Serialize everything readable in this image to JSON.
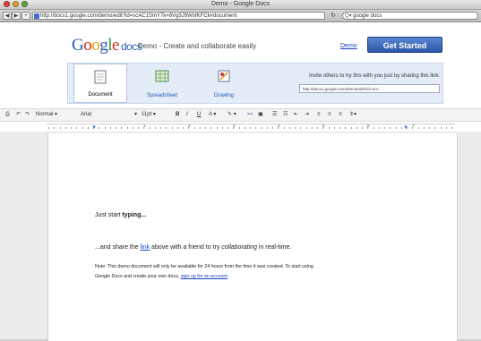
{
  "window": {
    "title": "Demo - Google Docs"
  },
  "browser": {
    "url": "http://docs1.google.com/demo/edit?id=scAC1SmY7k=8Vg3J9WofKFCk#document",
    "search_value": "google docs",
    "search_prefix": "Q▾"
  },
  "header": {
    "logo_text": "Google",
    "logo_docs": "docs",
    "tagline": "Demo - Create and collaborate easily",
    "demo_link": "Demo",
    "get_started_label": "Get Started"
  },
  "chooser": {
    "options": [
      {
        "label": "Document",
        "icon": "document-icon",
        "selected": true
      },
      {
        "label": "Spreadsheet",
        "icon": "spreadsheet-icon",
        "selected": false
      },
      {
        "label": "Drawing",
        "icon": "drawing-icon",
        "selected": false
      }
    ],
    "invite_text": "Invite others to try this with you just by sharing this link:",
    "share_url": "http://docs1.google.com/demo/edit?id=scA"
  },
  "editor_toolbar": {
    "style_dropdown": "Normal ▾",
    "font_dropdown": "Arial",
    "size_dropdown": "11pt ▾",
    "bold": "B",
    "italic": "I",
    "underline": "U",
    "text_color": "A ▾",
    "highlight": "✎ ▾"
  },
  "ruler": {
    "numbers": [
      "1",
      "2",
      "3",
      "4",
      "5",
      "6",
      "7"
    ]
  },
  "document": {
    "line1_prefix": "Just start ",
    "line1_bold": "typing...",
    "line2_a": "...and share the ",
    "line2_link": "link",
    "line2_b": " above with a friend to try ",
    "line2_italic": "collaborating",
    "line2_c": " in real-time.",
    "note_line1": "Note: This demo document will only be available for 24 hours from the time it was created. To start using",
    "note_line2_a": "Google Docs and create your own docs, ",
    "note_line2_link": "sign up for an account",
    "note_line2_b": "."
  },
  "colors": {
    "accent": "#2d57a7",
    "chooser_bg": "#e3ecf7",
    "link": "#1a3fc4"
  }
}
